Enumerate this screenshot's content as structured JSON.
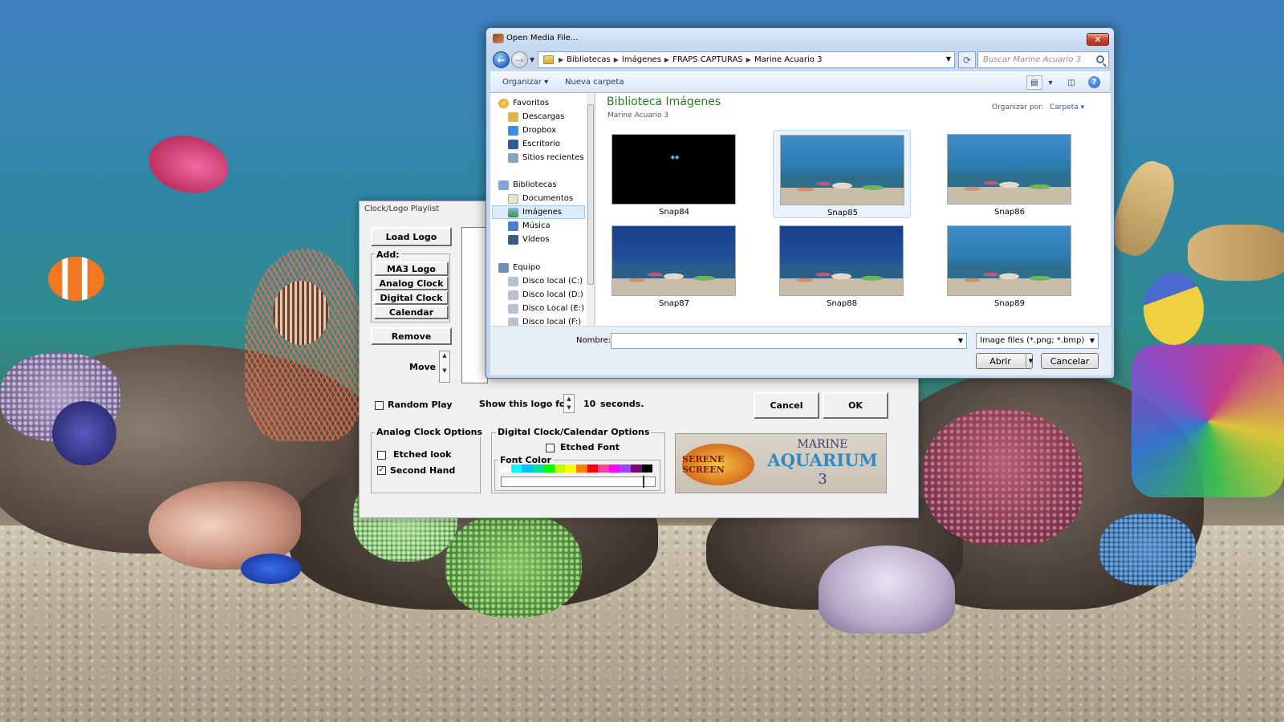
{
  "playlist": {
    "title": "Clock/Logo Playlist",
    "load_logo": "Load  Logo",
    "add_label": "Add:",
    "add_items": [
      "MA3 Logo",
      "Analog Clock",
      "Digital Clock",
      "Calendar"
    ],
    "remove": "Remove",
    "move": "Move",
    "random_play": "Random Play",
    "random_play_checked": false,
    "show_logo_for": "Show this logo for:",
    "seconds_value": "10",
    "seconds_unit": "seconds.",
    "cancel": "Cancel",
    "ok": "OK",
    "analog_group": "Analog Clock Options",
    "etched_look": "Etched look",
    "etched_look_checked": false,
    "second_hand": "Second Hand",
    "second_hand_checked": true,
    "digital_group": "Digital Clock/Calendar Options",
    "etched_font": "Etched Font",
    "etched_font_checked": false,
    "font_color": "Font Color",
    "font_colors": [
      "#ffffff",
      "#00ffff",
      "#00c0ff",
      "#00e0a0",
      "#00ff00",
      "#c0ff00",
      "#ffff00",
      "#ff8000",
      "#ff0000",
      "#ff40a0",
      "#ff00ff",
      "#a040ff",
      "#800080",
      "#000000"
    ],
    "logo_serene_screen": "SERENE SCREEN",
    "logo_marine": "MARINE",
    "logo_aquarium": "AQUARIUM",
    "logo_number": "3"
  },
  "open_dialog": {
    "title": "Open Media File...",
    "breadcrumb": [
      "Bibliotecas",
      "Imágenes",
      "FRAPS CAPTURAS",
      "Marine Acuario 3"
    ],
    "search_placeholder": "Buscar Marine Acuario 3",
    "toolbar": {
      "organize": "Organizar",
      "new_folder": "Nueva carpeta"
    },
    "nav": {
      "favorites_header": "Favoritos",
      "favorites": [
        "Descargas",
        "Dropbox",
        "Escritorio",
        "Sitios recientes"
      ],
      "libraries_header": "Bibliotecas",
      "libraries": [
        "Documentos",
        "Imágenes",
        "Música",
        "Vídeos"
      ],
      "computer_header": "Equipo",
      "drives": [
        "Disco local (C:)",
        "Disco local (D:)",
        "Disco Local (E:)",
        "Disco local (F:)"
      ]
    },
    "library_title": "Biblioteca Imágenes",
    "library_subtitle": "Marine Acuario 3",
    "organize_by_label": "Organizar por:",
    "organize_by_value": "Carpeta",
    "files": [
      "Snap84",
      "Snap85",
      "Snap86",
      "Snap87",
      "Snap88",
      "Snap89"
    ],
    "selected_file": "Snap85",
    "filename_label": "Nombre:",
    "filename_value": "",
    "file_type": "Image files (*.png; *.bmp)",
    "open_button": "Abrir",
    "cancel_button": "Cancelar"
  },
  "colors": {
    "library_title": "#2a7a2a",
    "link_blue": "#1b5fc0",
    "selection": "#dcebfc"
  }
}
